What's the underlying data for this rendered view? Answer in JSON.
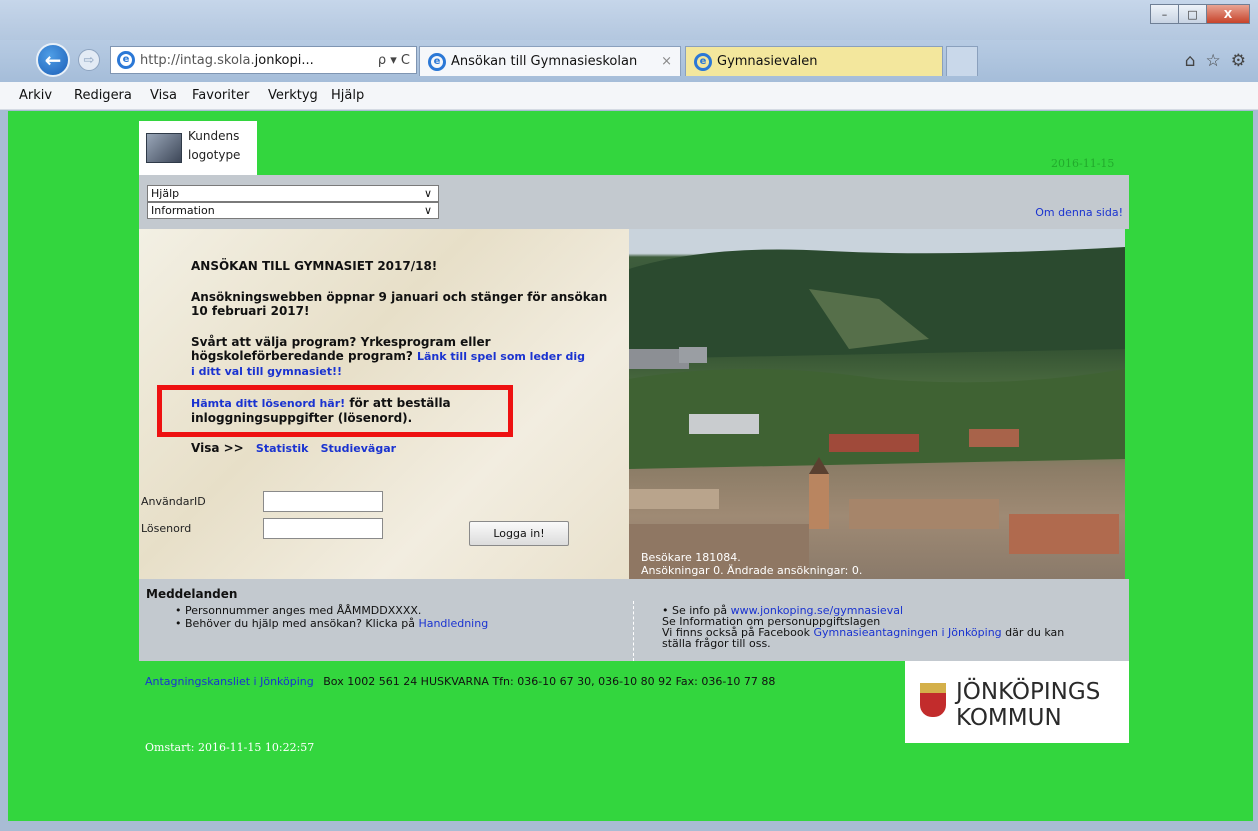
{
  "window": {
    "minimize": "–",
    "maximize": "□",
    "close": "X"
  },
  "browser": {
    "back_glyph": "←",
    "forward_glyph": "⇨",
    "address_prefix": "http://intag.skola.",
    "address_host": "jonkopi...",
    "address_tools": "ρ ▾ C",
    "tabs": [
      {
        "label": "Ansökan till Gymnasieskolan",
        "close": "×"
      },
      {
        "label": "Gymnasievalen"
      }
    ],
    "home_glyph": "⌂",
    "fav_glyph": "☆",
    "settings_glyph": "⚙"
  },
  "menu": [
    "Arkiv",
    "Redigera",
    "Visa",
    "Favoriter",
    "Verktyg",
    "Hjälp"
  ],
  "page": {
    "logo": {
      "line1": "Kundens",
      "line2": "logotype"
    },
    "date_top": "2016-11-15",
    "selects": [
      {
        "value": "Hjälp",
        "chevron": "∨"
      },
      {
        "value": "Information",
        "chevron": "∨"
      }
    ],
    "om_link": "Om denna sida!",
    "content": {
      "heading": "ANSÖKAN TILL GYMNASIET 2017/18!",
      "dates": "Ansökningswebben öppnar 9 januari och stänger för ansökan 10 februari 2017!",
      "choose_text": "Svårt att välja program? Yrkesprogram eller högskoleförberedande program?",
      "choose_link": "Länk till spel som leder dig i ditt val till gymnasiet!!",
      "password_link": "Hämta ditt lösenord här!",
      "password_text": " för att beställa inloggningsuppgifter (lösenord).",
      "visa_label": "Visa >>",
      "statistik_link": "Statistik",
      "studievagar_link": "Studievägar"
    },
    "login": {
      "user_label": "AnvändarID",
      "password_label": "Lösenord",
      "button": "Logga in!"
    },
    "photo_overlay": {
      "visitors": "Besökare 181084.",
      "applications": "Ansökningar 0. Ändrade ansökningar: 0."
    },
    "messages": {
      "title": "Meddelanden",
      "left": [
        {
          "text": "Personnummer anges med ÅÅMMDDXXXX.",
          "link": ""
        },
        {
          "text": "Behöver du hjälp med ansökan? Klicka på ",
          "link": "Handledning"
        }
      ],
      "right_info_text": "Se info på ",
      "right_info_link": "www.jonkoping.se/gymnasieval",
      "right_pul": "Se Information om personuppgiftslagen",
      "right_fb_text": "Vi finns också på Facebook ",
      "right_fb_link": "Gymnasieantagningen i Jönköping",
      "right_fb_suffix": " där du kan",
      "right_fb_line2": "ställa frågor till oss.",
      "bullet": "•"
    },
    "footer": {
      "office_link": "Antagningskansliet i Jönköping",
      "address": "Box 1002   561 24 HUSKVARNA   Tfn: 036-10 67 30, 036-10 80 92   Fax: 036-10 77 88"
    },
    "kommun": {
      "line1": "JÖNKÖPINGS",
      "line2": "KOMMUN"
    },
    "omstart": "Omstart: 2016-11-15 10:22:57"
  },
  "colors": {
    "page_background": "#33d63e",
    "link": "#1a33d0",
    "highlight_box": "#ee1111",
    "panel_grey": "#c3c9cf"
  }
}
